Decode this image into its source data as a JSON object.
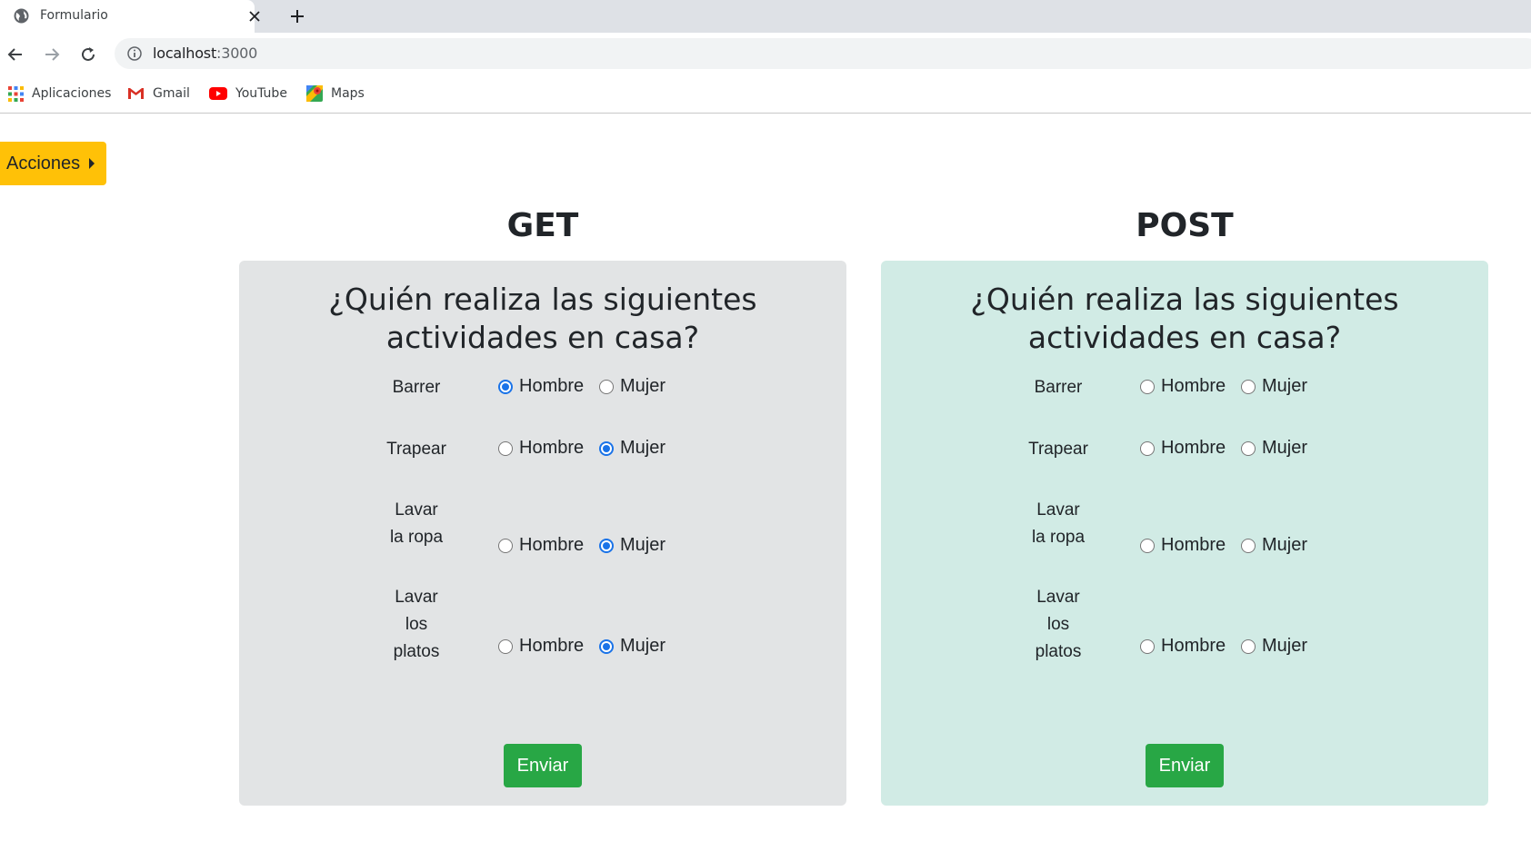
{
  "browser": {
    "tab_title": "Formulario",
    "url_host": "localhost",
    "url_port": ":3000",
    "bookmarks": [
      "Aplicaciones",
      "Gmail",
      "YouTube",
      "Maps"
    ]
  },
  "page": {
    "actions_button": "Acciones",
    "forms": [
      {
        "method": "GET",
        "heading_line1": "¿Quién realiza las siguientes",
        "heading_line2": "actividades en casa?",
        "submit": "Enviar",
        "rows": [
          {
            "label_lines": [
              "Barrer"
            ],
            "selected": "Hombre"
          },
          {
            "label_lines": [
              "Trapear"
            ],
            "selected": "Mujer"
          },
          {
            "label_lines": [
              "Lavar",
              "la ropa"
            ],
            "selected": "Mujer"
          },
          {
            "label_lines": [
              "Lavar",
              "los",
              "platos"
            ],
            "selected": "Mujer"
          }
        ]
      },
      {
        "method": "POST",
        "heading_line1": "¿Quién realiza las siguientes",
        "heading_line2": "actividades en casa?",
        "submit": "Enviar",
        "rows": [
          {
            "label_lines": [
              "Barrer"
            ],
            "selected": ""
          },
          {
            "label_lines": [
              "Trapear"
            ],
            "selected": ""
          },
          {
            "label_lines": [
              "Lavar",
              "la ropa"
            ],
            "selected": ""
          },
          {
            "label_lines": [
              "Lavar",
              "los",
              "platos"
            ],
            "selected": ""
          }
        ]
      }
    ],
    "options": [
      "Hombre",
      "Mujer"
    ]
  },
  "colors": {
    "get_card": "#e2e4e5",
    "post_card": "#d1ebe5",
    "actions_button": "#ffc107",
    "submit_button": "#28a745",
    "radio_checked": "#1a73e8"
  }
}
